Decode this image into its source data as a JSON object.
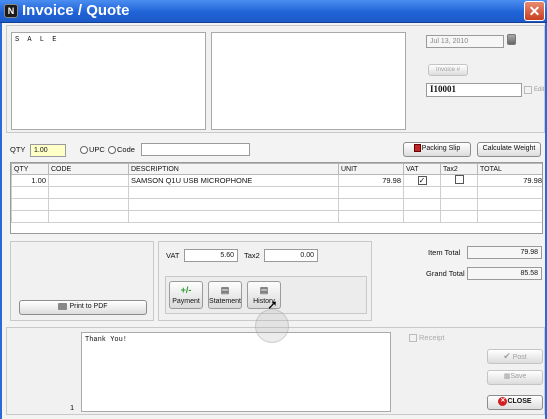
{
  "window": {
    "title": "Invoice / Quote",
    "app_icon_letter": "N",
    "close_label": "✕",
    "title_color": "#2063d8"
  },
  "header": {
    "customer_text": "S A L E",
    "ship_text": "",
    "date": "Jul 13, 2010",
    "calendar_icon": "calendar-icon",
    "invoice_button": "Invoice #",
    "invoice_number": "I10001",
    "edit_label": "Edit"
  },
  "entry": {
    "qty_label": "QTY",
    "qty_value": "1.00",
    "upc_label": "UPC",
    "code_label": "Code",
    "code_value": "",
    "packing_slip": "Packing Slip",
    "calculate_weight": "Calculate Weight"
  },
  "table": {
    "columns": [
      "QTY",
      "CODE",
      "DESCRIPTION",
      "UNIT",
      "VAT",
      "Tax2",
      "TOTAL"
    ],
    "rows": [
      {
        "qty": "1.00",
        "code": "",
        "description": "SAMSON Q1U USB MICROPHONE",
        "unit": "79.98",
        "vat": true,
        "tax2": false,
        "total": "79.98"
      }
    ]
  },
  "actions": {
    "print_pdf": "Print to PDF",
    "vat_label": "VAT",
    "vat_value": "5.60",
    "tax2_label": "Tax2",
    "tax2_value": "0.00",
    "payment": "Payment",
    "payment_icon": "+/-",
    "statement": "Statement",
    "history": "History"
  },
  "totals": {
    "item_total_label": "Item Total",
    "item_total": "79.98",
    "grand_total_label": "Grand Total",
    "grand_total": "85.58"
  },
  "footer": {
    "note": "Thank You!",
    "page_number": "1",
    "receipt_label": "Receipt",
    "post": "Post",
    "save": "Save",
    "close": "CLOSE"
  }
}
